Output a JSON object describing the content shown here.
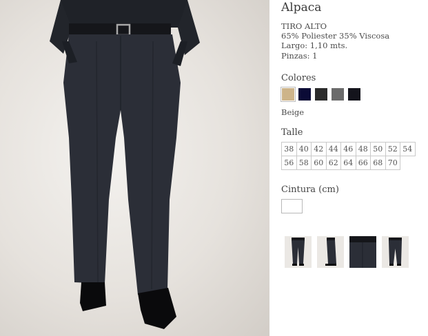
{
  "product": {
    "title": "Alpaca",
    "specs": [
      "TIRO ALTO",
      "65% Poliester 35% Viscosa",
      "Largo: 1,10 mts.",
      "Pinzas: 1"
    ]
  },
  "colors": {
    "label": "Colores",
    "selected_name": "Beige",
    "swatches": [
      "#cdb48a",
      "#0b0b36",
      "#2b2b2b",
      "#6b6b6b",
      "#14141c"
    ]
  },
  "sizes": {
    "label": "Talle",
    "values": [
      "38",
      "40",
      "42",
      "44",
      "46",
      "48",
      "50",
      "52",
      "54",
      "56",
      "58",
      "60",
      "62",
      "64",
      "66",
      "68",
      "70"
    ]
  },
  "waist": {
    "label": "Cintura (cm)",
    "value": ""
  },
  "gallery": {
    "thumbnails": [
      "pants-front-thumbnail",
      "pants-side-thumbnail",
      "pants-belt-detail-thumbnail",
      "pants-back-thumbnail"
    ]
  }
}
